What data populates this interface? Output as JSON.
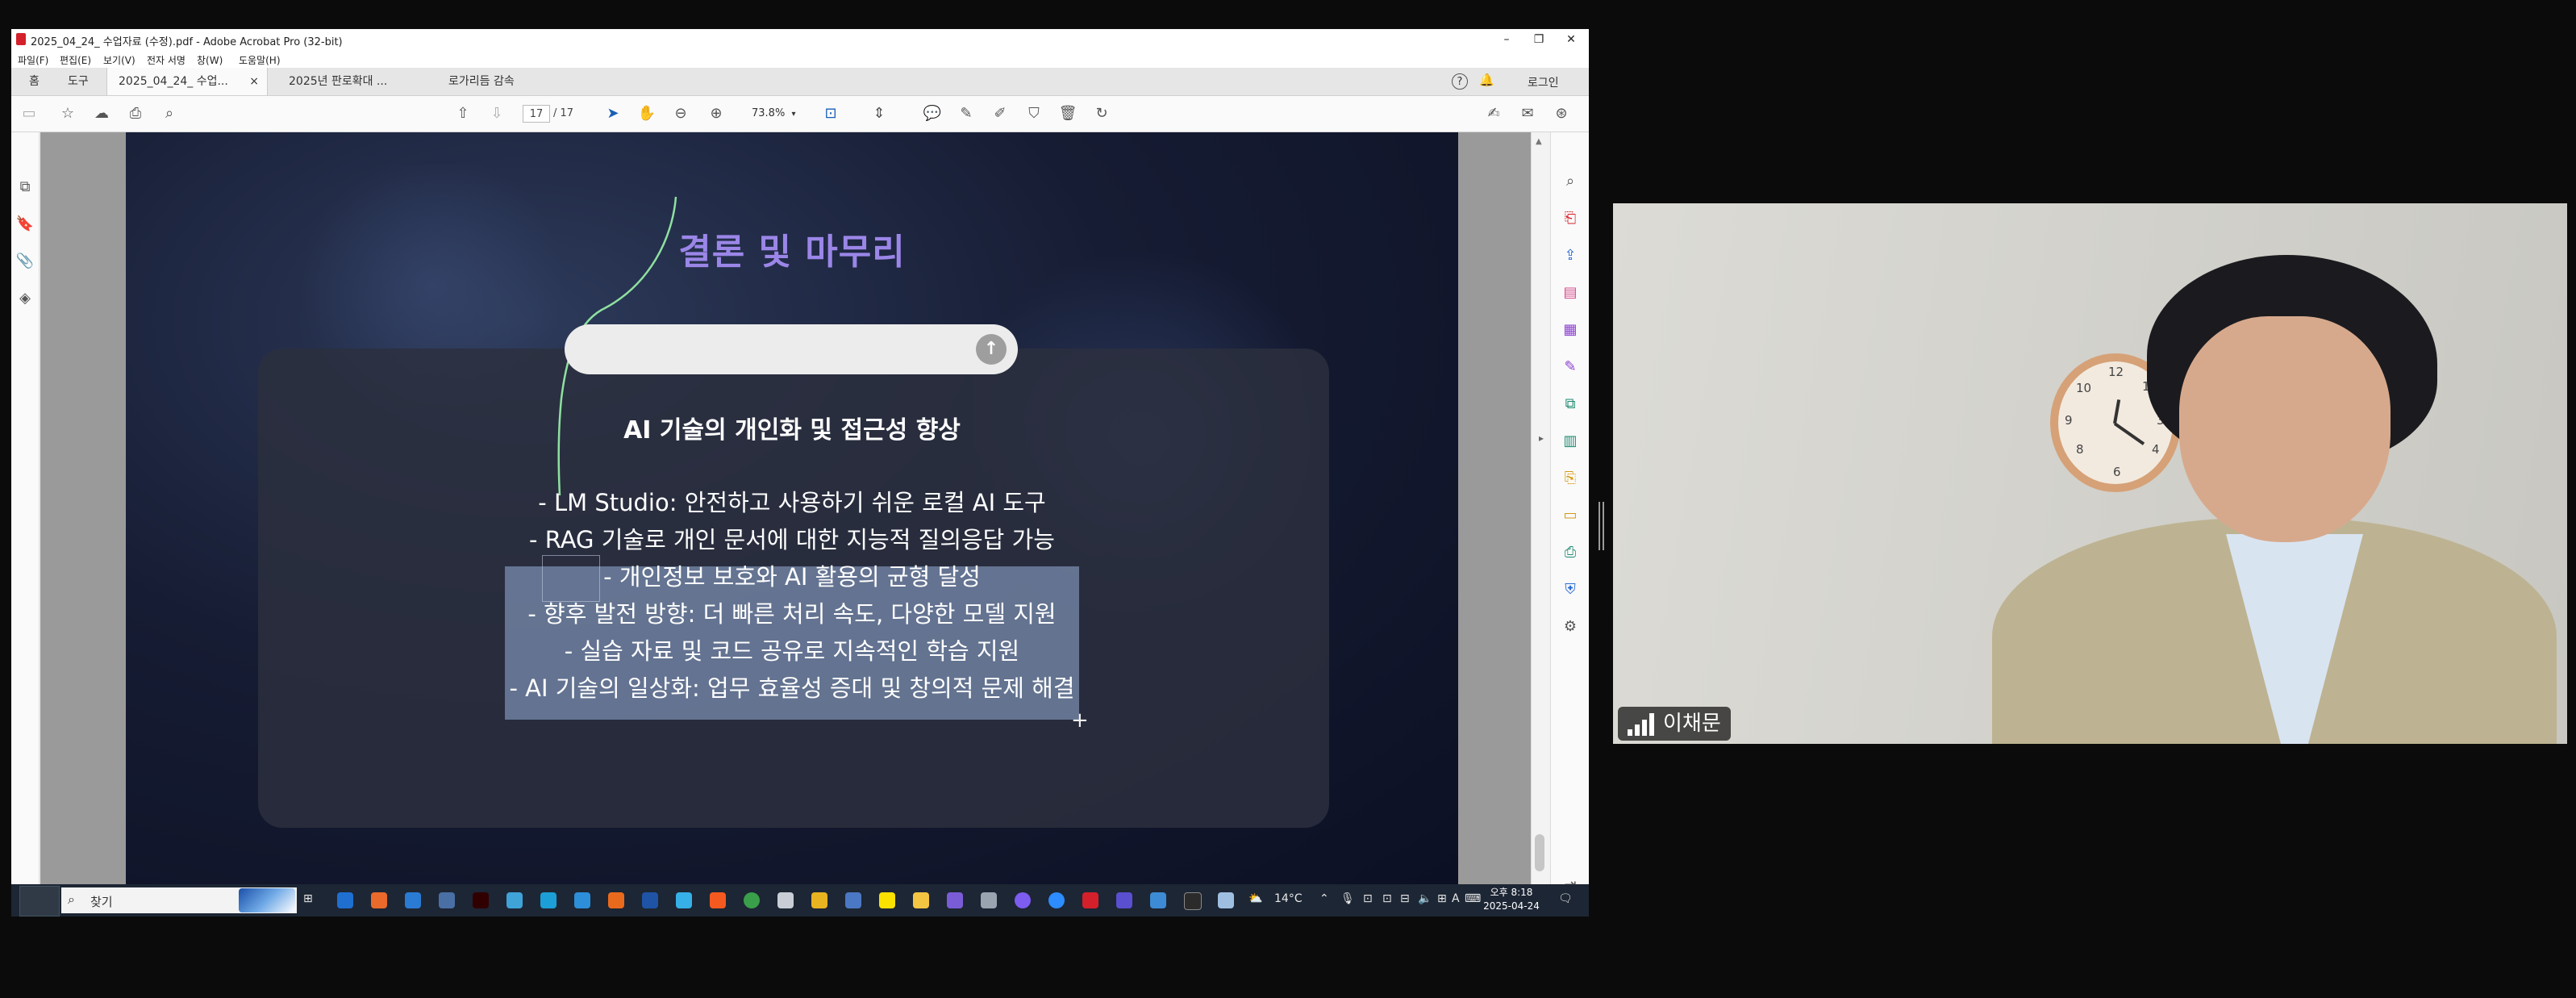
{
  "window": {
    "title": "2025_04_24_ 수업자료 (수정).pdf - Adobe Acrobat Pro (32-bit)",
    "minimize": "–",
    "restore": "❐",
    "close": "✕"
  },
  "menu": [
    "파일(F)",
    "편집(E)",
    "보기(V)",
    "전자 서명",
    "창(W)",
    "도움말(H)"
  ],
  "tabs": {
    "home": "홈",
    "tools": "도구",
    "doc1": "2025_04_24_ 수업...",
    "doc1_close": "×",
    "doc2": "2025년 판로확대 ...",
    "doc3": "로가리듬 감속"
  },
  "header_right": {
    "help_icon": "?",
    "bell_icon": "🔔",
    "login": "로그인"
  },
  "toolbar": {
    "page_current": "17",
    "page_total": "/ 17",
    "zoom": "73.8%"
  },
  "slide": {
    "title": "결론 및 마무리",
    "subtitle": "AI 기술의 개인화 및 접근성 향상",
    "send_icon": "↑",
    "bullets": [
      "- LM Studio: 안전하고 사용하기 쉬운 로컬 AI 도구",
      "- RAG 기술로 개인 문서에 대한 지능적 질의응답 가능",
      "- 개인정보 보호와 AI 활용의 균형 달성",
      "- 향후 발전 방향: 더 빠른 처리 속도, 다양한 모델 지원",
      "- 실습 자료 및 코드 공유로 지속적인 학습 지원",
      "- AI 기술의 일상화: 업무 효율성 증대 및 창의적 문제 해결"
    ]
  },
  "taskbar": {
    "search_label": "찾기",
    "weather": "14°C",
    "ime": "A",
    "clock_time": "오후 8:18",
    "clock_date": "2025-04-24"
  },
  "video": {
    "participant_name": "이채문"
  },
  "colors": {
    "slide_title": "#9b86e8",
    "acrobat_red": "#d4202a",
    "taskbar": "#1d2634"
  }
}
